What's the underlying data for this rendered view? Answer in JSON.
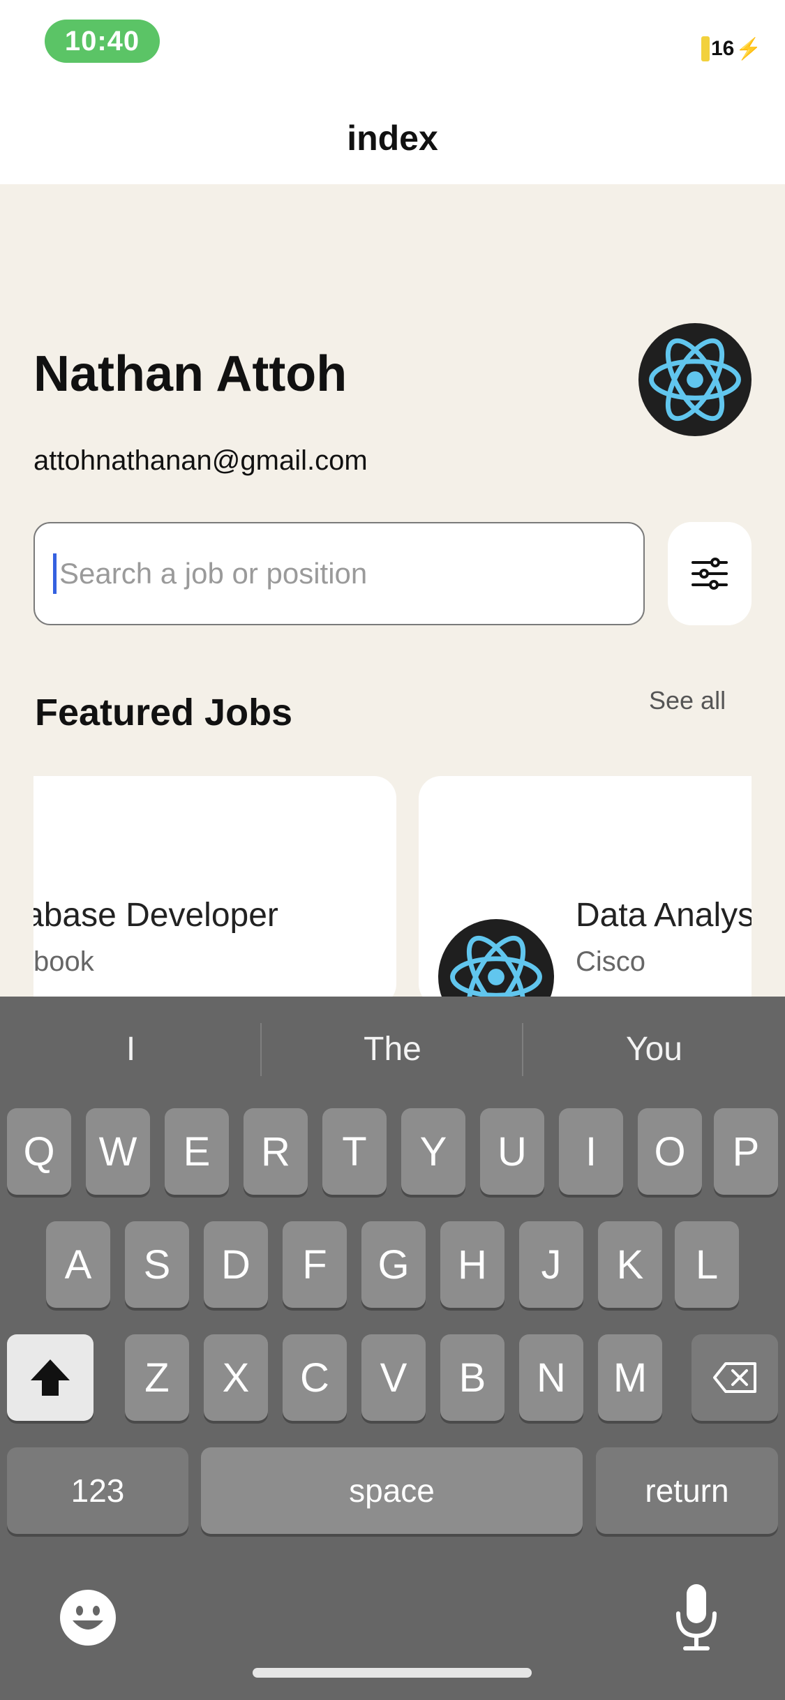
{
  "status": {
    "time": "10:40",
    "battery": "16"
  },
  "header": {
    "title": "index"
  },
  "profile": {
    "name": "Nathan Attoh",
    "email": "attohnathanan@gmail.com"
  },
  "search": {
    "placeholder": "Search a job or position"
  },
  "featured": {
    "title": "Featured Jobs",
    "see_all": "See all",
    "jobs": [
      {
        "title": "abase Developer",
        "company": "book"
      },
      {
        "title": "Data Analys",
        "company": "Cisco"
      }
    ]
  },
  "keyboard": {
    "suggestions": [
      "I",
      "The",
      "You"
    ],
    "row1": [
      "Q",
      "W",
      "E",
      "R",
      "T",
      "Y",
      "U",
      "I",
      "O",
      "P"
    ],
    "row2": [
      "A",
      "S",
      "D",
      "F",
      "G",
      "H",
      "J",
      "K",
      "L"
    ],
    "row3": [
      "Z",
      "X",
      "C",
      "V",
      "B",
      "N",
      "M"
    ],
    "numbers_label": "123",
    "space_label": "space",
    "return_label": "return"
  },
  "colors": {
    "time_pill": "#5bc466",
    "background": "#f4f0e8",
    "keyboard": "#666666",
    "caret": "#3561e0"
  }
}
